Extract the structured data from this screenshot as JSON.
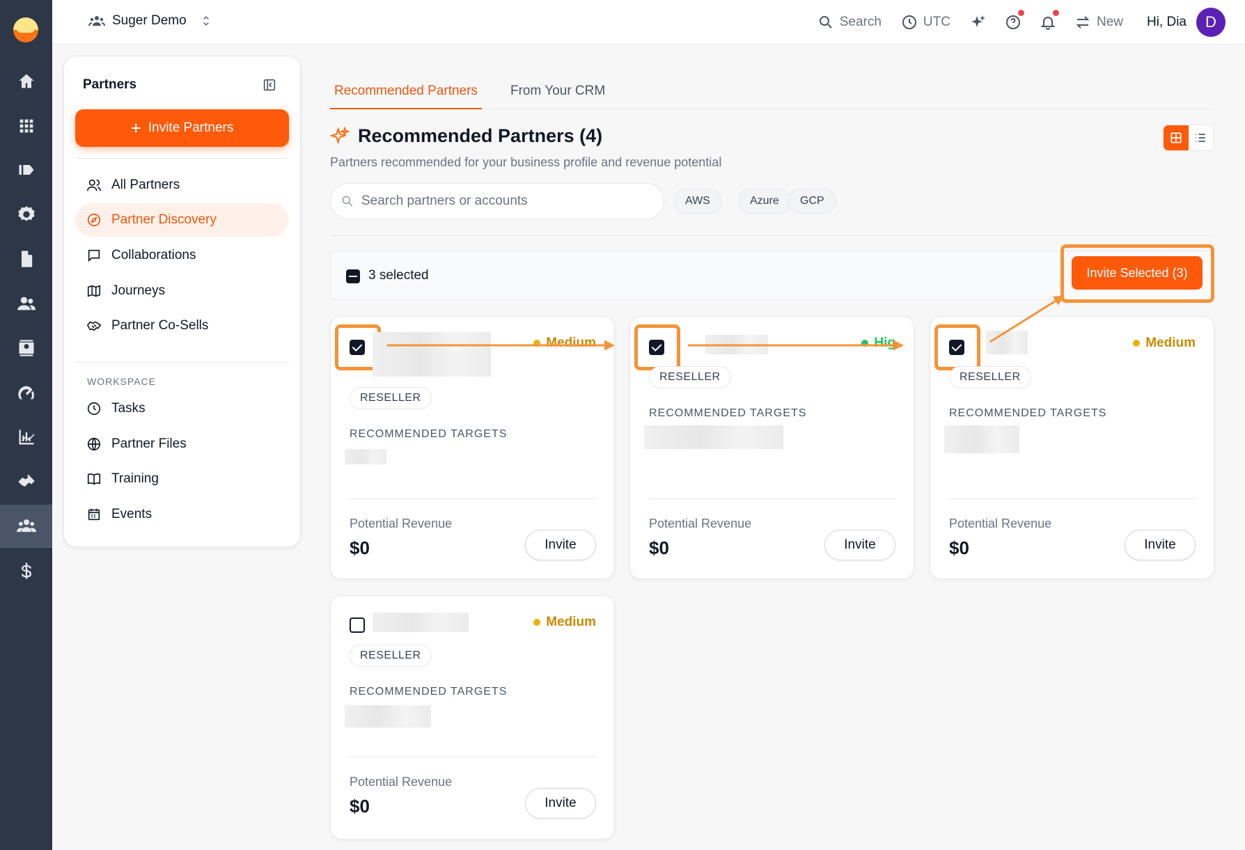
{
  "topbar": {
    "org_name": "Suger Demo",
    "search_label": "Search",
    "timezone_label": "UTC",
    "new_label": "New",
    "greeting": "Hi, Dia",
    "avatar_initial": "D"
  },
  "sidebar": {
    "title": "Partners",
    "invite_button": "Invite Partners",
    "items": [
      {
        "label": "All Partners",
        "icon": "users-icon"
      },
      {
        "label": "Partner Discovery",
        "icon": "compass-icon",
        "active": true
      },
      {
        "label": "Collaborations",
        "icon": "chat-icon"
      },
      {
        "label": "Journeys",
        "icon": "map-icon"
      },
      {
        "label": "Partner Co-Sells",
        "icon": "handshake-icon"
      }
    ],
    "workspace_label": "WORKSPACE",
    "workspace_items": [
      {
        "label": "Tasks",
        "icon": "clock-icon"
      },
      {
        "label": "Partner Files",
        "icon": "globe-icon"
      },
      {
        "label": "Training",
        "icon": "book-icon"
      },
      {
        "label": "Events",
        "icon": "calendar-icon"
      }
    ]
  },
  "main": {
    "tabs": [
      {
        "label": "Recommended Partners",
        "active": true
      },
      {
        "label": "From Your CRM",
        "active": false
      }
    ],
    "title": "Recommended Partners (4)",
    "subtitle": "Partners recommended for your business profile and revenue potential",
    "search_placeholder": "Search partners or accounts",
    "filters": [
      "AWS",
      "Azure",
      "GCP"
    ],
    "selection_text": "3 selected",
    "invite_selected_label": "Invite Selected (3)"
  },
  "cards": [
    {
      "tier": "Medium",
      "tier_color": "#eab308",
      "type": "RESELLER",
      "targets_label": "RECOMMENDED TARGETS",
      "revenue_label": "Potential Revenue",
      "revenue": "$0",
      "invite_label": "Invite",
      "checked": true
    },
    {
      "tier": "Hig",
      "tier_color": "#22c55e",
      "type": "RESELLER",
      "targets_label": "RECOMMENDED TARGETS",
      "revenue_label": "Potential Revenue",
      "revenue": "$0",
      "invite_label": "Invite",
      "checked": true
    },
    {
      "tier": "Medium",
      "tier_color": "#eab308",
      "type": "RESELLER",
      "targets_label": "RECOMMENDED TARGETS",
      "revenue_label": "Potential Revenue",
      "revenue": "$0",
      "invite_label": "Invite",
      "checked": true
    },
    {
      "tier": "Medium",
      "tier_color": "#eab308",
      "type": "RESELLER",
      "targets_label": "RECOMMENDED TARGETS",
      "revenue_label": "Potential Revenue",
      "revenue": "$0",
      "invite_label": "Invite",
      "checked": false
    }
  ],
  "colors": {
    "accent": "#ff5a0a",
    "annotation": "#f59337",
    "rail": "#2d3748"
  }
}
